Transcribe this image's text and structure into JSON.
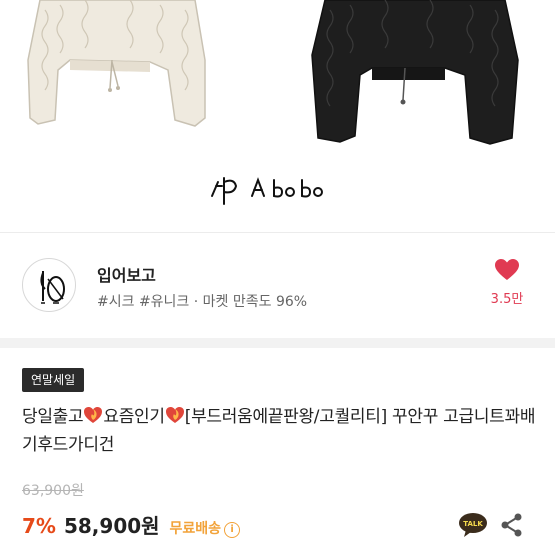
{
  "product_image": {
    "brand_signature": "ip A bobo"
  },
  "shop": {
    "name": "입어보고",
    "tags": "#시크 #유니크 · 마켓 만족도 96%",
    "like_count": "3.5만",
    "logo_icon": "shop-logo-icon"
  },
  "product": {
    "badge": "연말세일",
    "title_part1": "당일출고",
    "title_part2": "요즘인기",
    "title_part3": "[부드러움에끝판왕/고퀄리티] 꾸안꾸 고급니트꽈배기후드가디건",
    "original_price": "63,900원",
    "discount": "7%",
    "price": "58,900원",
    "shipping": "무료배송",
    "info_icon_glyph": "i"
  },
  "actions": {
    "talk_label": "TALK",
    "share_icon": "share-icon",
    "heart_icon": "heart-icon"
  },
  "colors": {
    "discount": "#e64a19",
    "shipping": "#f2a33a",
    "like": "#e03a52",
    "badge_bg": "#2b2b2b",
    "talk_bg": "#3b2c1c"
  }
}
